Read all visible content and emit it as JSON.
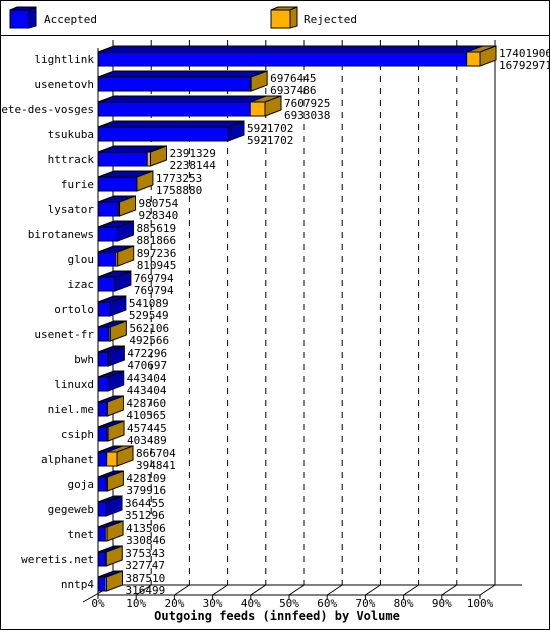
{
  "chart_data": {
    "type": "bar",
    "orientation": "horizontal",
    "style": "3d-stacked",
    "title": "",
    "xlabel": "Outgoing feeds (innfeed) by Volume",
    "ylabel": "",
    "x_tick_labels": [
      "0%",
      "10%",
      "20%",
      "30%",
      "40%",
      "50%",
      "60%",
      "70%",
      "80%",
      "90%",
      "100%"
    ],
    "x_max_value": 17401906,
    "grid": "vertical-dashed",
    "legend": {
      "placement": "top",
      "entries": [
        {
          "name": "Accepted",
          "color": "#0000ff",
          "side_color": "#0000a8"
        },
        {
          "name": "Rejected",
          "color": "#ffb000",
          "side_color": "#b08000"
        }
      ]
    },
    "categories": [
      "lightlink",
      "usenetovh",
      "bete-des-vosges",
      "tsukuba",
      "httrack",
      "furie",
      "lysator",
      "birotanews",
      "glou",
      "izac",
      "ortolo",
      "usenet-fr",
      "bwh",
      "linuxd",
      "niel.me",
      "csiph",
      "alphanet",
      "goja",
      "gegeweb",
      "tnet",
      "weretis.net",
      "nntp4"
    ],
    "offered": [
      17401906,
      6976445,
      7607925,
      5921702,
      2391329,
      1773253,
      980754,
      885619,
      897236,
      769794,
      541089,
      562106,
      472296,
      443404,
      428760,
      457445,
      866704,
      428109,
      364455,
      413506,
      375343,
      387510
    ],
    "accepted": [
      16792971,
      6937486,
      6933038,
      5921702,
      2238144,
      1758880,
      928340,
      881866,
      810945,
      769794,
      529549,
      492566,
      470697,
      443404,
      410565,
      403489,
      394841,
      379916,
      351296,
      330846,
      327747,
      316499
    ],
    "series": [
      {
        "name": "Accepted",
        "values": [
          16792971,
          6937486,
          6933038,
          5921702,
          2238144,
          1758880,
          928340,
          881866,
          810945,
          769794,
          529549,
          492566,
          470697,
          443404,
          410565,
          403489,
          394841,
          379916,
          351296,
          330846,
          327747,
          316499
        ]
      },
      {
        "name": "Rejected",
        "values": [
          608935,
          38959,
          674887,
          0,
          153185,
          14373,
          52414,
          3753,
          86291,
          0,
          11540,
          69540,
          1599,
          0,
          18195,
          53956,
          471863,
          48193,
          13159,
          82660,
          47596,
          71011
        ]
      }
    ]
  }
}
